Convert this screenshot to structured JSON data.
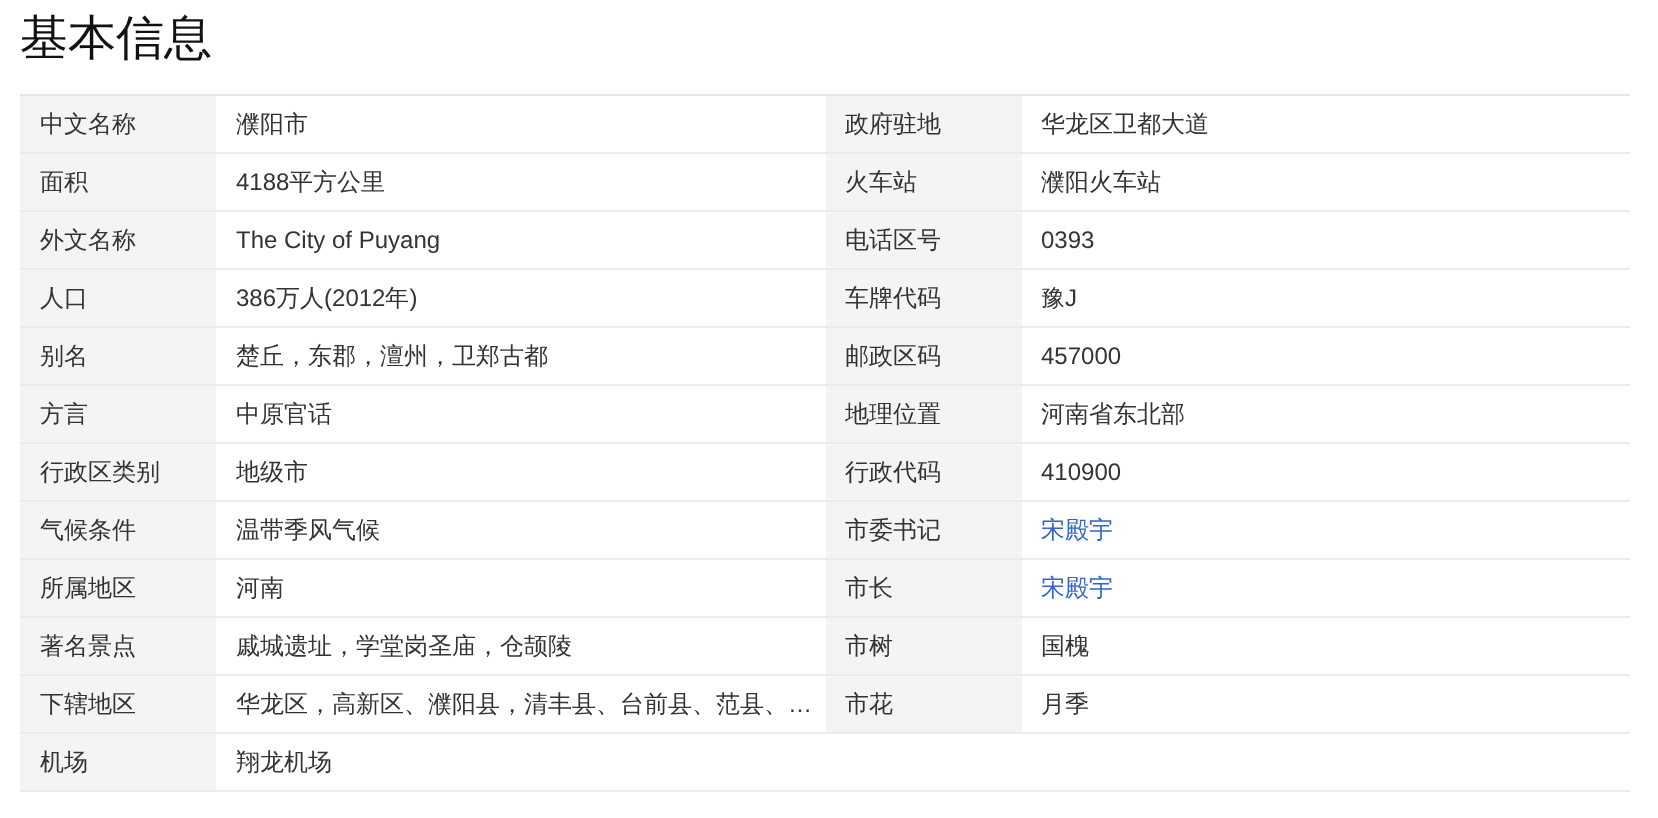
{
  "title": "基本信息",
  "rows": [
    {
      "pairs": [
        {
          "label": "中文名称",
          "value": "濮阳市",
          "link": false
        },
        {
          "label": "政府驻地",
          "value": "华龙区卫都大道",
          "link": false
        }
      ]
    },
    {
      "pairs": [
        {
          "label": "面积",
          "value": "4188平方公里",
          "link": false
        },
        {
          "label": "火车站",
          "value": "濮阳火车站",
          "link": false
        }
      ]
    },
    {
      "pairs": [
        {
          "label": "外文名称",
          "value": "The City of Puyang",
          "link": false
        },
        {
          "label": "电话区号",
          "value": "0393",
          "link": false
        }
      ]
    },
    {
      "pairs": [
        {
          "label": "人口",
          "value": "386万人(2012年)",
          "link": false
        },
        {
          "label": "车牌代码",
          "value": "豫J",
          "link": false
        }
      ]
    },
    {
      "pairs": [
        {
          "label": "别名",
          "value": "楚丘，东郡，澶州，卫郑古都",
          "link": false
        },
        {
          "label": "邮政区码",
          "value": "457000",
          "link": false
        }
      ]
    },
    {
      "pairs": [
        {
          "label": "方言",
          "value": "中原官话",
          "link": false
        },
        {
          "label": "地理位置",
          "value": "河南省东北部",
          "link": false
        }
      ]
    },
    {
      "pairs": [
        {
          "label": "行政区类别",
          "value": "地级市",
          "link": false
        },
        {
          "label": "行政代码",
          "value": "410900",
          "link": false
        }
      ]
    },
    {
      "pairs": [
        {
          "label": "气候条件",
          "value": "温带季风气候",
          "link": false
        },
        {
          "label": "市委书记",
          "value": "宋殿宇",
          "link": true
        }
      ]
    },
    {
      "pairs": [
        {
          "label": "所属地区",
          "value": "河南",
          "link": false
        },
        {
          "label": "市长",
          "value": "宋殿宇",
          "link": true
        }
      ]
    },
    {
      "pairs": [
        {
          "label": "著名景点",
          "value": "戚城遗址，学堂岗圣庙，仓颉陵",
          "link": false
        },
        {
          "label": "市树",
          "value": "国槐",
          "link": false
        }
      ]
    },
    {
      "pairs": [
        {
          "label": "下辖地区",
          "value": "华龙区，高新区、濮阳县，清丰县、台前县、范县、…",
          "link": false
        },
        {
          "label": "市花",
          "value": "月季",
          "link": false
        }
      ]
    },
    {
      "pairs": [
        {
          "label": "机场",
          "value": "翔龙机场",
          "link": false
        }
      ]
    }
  ]
}
